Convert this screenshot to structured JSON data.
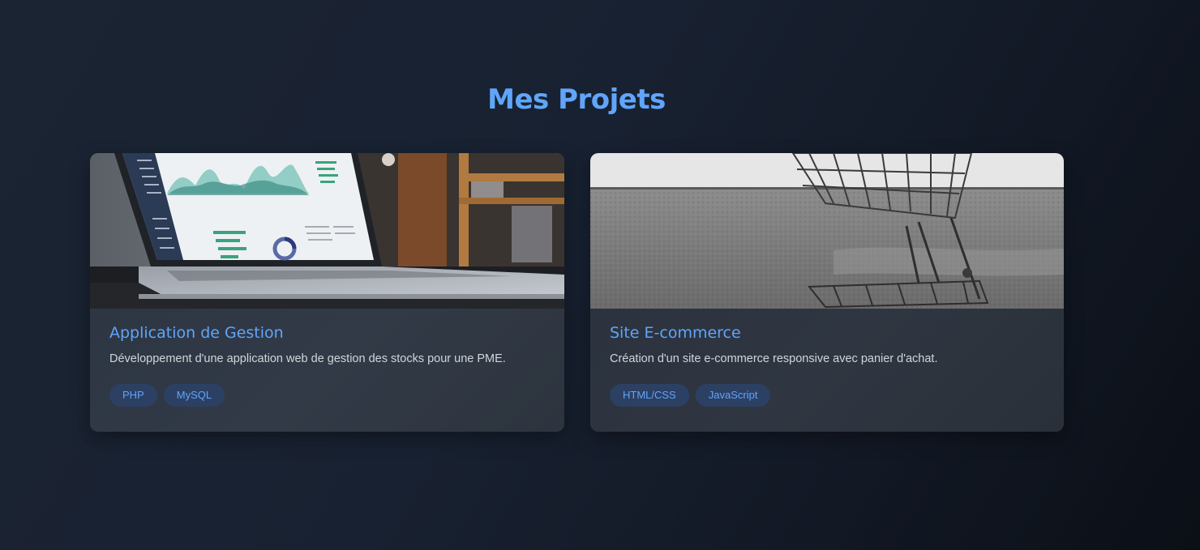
{
  "section": {
    "title": "Mes Projets"
  },
  "projects": [
    {
      "title": "Application de Gestion",
      "description": "Développement d'une application web de gestion des stocks pour une PME.",
      "image": "laptop-dashboard-photo",
      "tags": [
        "PHP",
        "MySQL"
      ]
    },
    {
      "title": "Site E-commerce",
      "description": "Création d'un site e-commerce responsive avec panier d'achat.",
      "image": "shopping-cart-photo",
      "tags": [
        "HTML/CSS",
        "JavaScript"
      ]
    }
  ],
  "colors": {
    "accent": "#60a5fa",
    "tag_bg": "#2c4064",
    "card_bg": "#2f3744",
    "page_bg": "#182131"
  }
}
